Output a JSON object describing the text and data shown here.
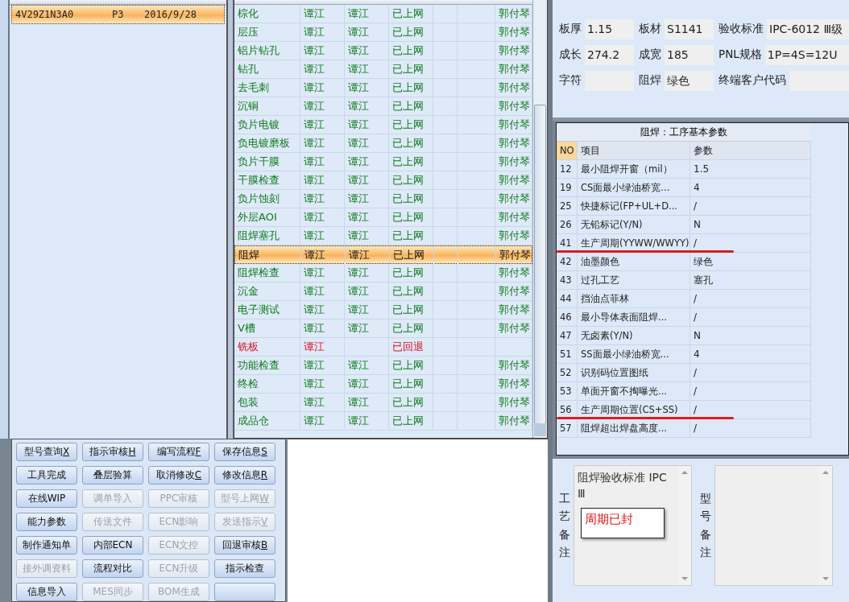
{
  "order_list": {
    "rows": [
      {
        "model": "4V29Z1N3A0",
        "layer": "P3",
        "date": "2016/9/28",
        "selected": true
      }
    ]
  },
  "process_table": {
    "rows": [
      {
        "step": "棕化",
        "operator": "谭江",
        "checker": "谭江",
        "state": "已上网",
        "owner": "郭付琴",
        "returned": false,
        "selected": false
      },
      {
        "step": "层压",
        "operator": "谭江",
        "checker": "谭江",
        "state": "已上网",
        "owner": "郭付琴",
        "returned": false,
        "selected": false
      },
      {
        "step": "铝片钻孔",
        "operator": "谭江",
        "checker": "谭江",
        "state": "已上网",
        "owner": "郭付琴",
        "returned": false,
        "selected": false
      },
      {
        "step": "钻孔",
        "operator": "谭江",
        "checker": "谭江",
        "state": "已上网",
        "owner": "郭付琴",
        "returned": false,
        "selected": false
      },
      {
        "step": "去毛刺",
        "operator": "谭江",
        "checker": "谭江",
        "state": "已上网",
        "owner": "郭付琴",
        "returned": false,
        "selected": false
      },
      {
        "step": "沉铜",
        "operator": "谭江",
        "checker": "谭江",
        "state": "已上网",
        "owner": "郭付琴",
        "returned": false,
        "selected": false
      },
      {
        "step": "负片电镀",
        "operator": "谭江",
        "checker": "谭江",
        "state": "已上网",
        "owner": "郭付琴",
        "returned": false,
        "selected": false
      },
      {
        "step": "负电镀磨板",
        "operator": "谭江",
        "checker": "谭江",
        "state": "已上网",
        "owner": "郭付琴",
        "returned": false,
        "selected": false
      },
      {
        "step": "负片干膜",
        "operator": "谭江",
        "checker": "谭江",
        "state": "已上网",
        "owner": "郭付琴",
        "returned": false,
        "selected": false
      },
      {
        "step": "干膜检查",
        "operator": "谭江",
        "checker": "谭江",
        "state": "已上网",
        "owner": "郭付琴",
        "returned": false,
        "selected": false
      },
      {
        "step": "负片蚀刻",
        "operator": "谭江",
        "checker": "谭江",
        "state": "已上网",
        "owner": "郭付琴",
        "returned": false,
        "selected": false
      },
      {
        "step": "外层AOI",
        "operator": "谭江",
        "checker": "谭江",
        "state": "已上网",
        "owner": "郭付琴",
        "returned": false,
        "selected": false
      },
      {
        "step": "阻焊塞孔",
        "operator": "谭江",
        "checker": "谭江",
        "state": "已上网",
        "owner": "郭付琴",
        "returned": false,
        "selected": false
      },
      {
        "step": "阻焊",
        "operator": "谭江",
        "checker": "谭江",
        "state": "已上网",
        "owner": "郭付琴",
        "returned": false,
        "selected": true
      },
      {
        "step": "阻焊检查",
        "operator": "谭江",
        "checker": "谭江",
        "state": "已上网",
        "owner": "郭付琴",
        "returned": false,
        "selected": false
      },
      {
        "step": "沉金",
        "operator": "谭江",
        "checker": "谭江",
        "state": "已上网",
        "owner": "郭付琴",
        "returned": false,
        "selected": false
      },
      {
        "step": "电子测试",
        "operator": "谭江",
        "checker": "谭江",
        "state": "已上网",
        "owner": "郭付琴",
        "returned": false,
        "selected": false
      },
      {
        "step": "V槽",
        "operator": "谭江",
        "checker": "谭江",
        "state": "已上网",
        "owner": "郭付琴",
        "returned": false,
        "selected": false
      },
      {
        "step": "铣板",
        "operator": "谭江",
        "state": "已回退",
        "returned": true,
        "selected": false
      },
      {
        "step": "功能检查",
        "operator": "谭江",
        "checker": "谭江",
        "state": "已上网",
        "owner": "郭付琴",
        "returned": false,
        "selected": false
      },
      {
        "step": "终检",
        "operator": "谭江",
        "checker": "谭江",
        "state": "已上网",
        "owner": "郭付琴",
        "returned": false,
        "selected": false
      },
      {
        "step": "包装",
        "operator": "谭江",
        "checker": "谭江",
        "state": "已上网",
        "owner": "郭付琴",
        "returned": false,
        "selected": false
      },
      {
        "step": "成品仓",
        "operator": "谭江",
        "checker": "谭江",
        "state": "已上网",
        "owner": "郭付琴",
        "returned": false,
        "selected": false
      }
    ]
  },
  "buttons": [
    {
      "label": "型号查询",
      "key": "X",
      "disabled": false
    },
    {
      "label": "指示审核",
      "key": "H",
      "disabled": false
    },
    {
      "label": "编写流程",
      "key": "F",
      "disabled": false
    },
    {
      "label": "保存信息",
      "key": "S",
      "disabled": false
    },
    {
      "label": "工具完成",
      "disabled": false
    },
    {
      "label": "叠层验算",
      "disabled": false
    },
    {
      "label": "取消修改",
      "key": "C",
      "disabled": false
    },
    {
      "label": "修改信息",
      "key": "R",
      "disabled": false
    },
    {
      "label": "在线WIP",
      "disabled": false
    },
    {
      "label": "调单导入",
      "disabled": true
    },
    {
      "label": "PPC审核",
      "disabled": true
    },
    {
      "label": "型号上网",
      "key": "W",
      "disabled": true
    },
    {
      "label": "能力参数",
      "disabled": false
    },
    {
      "label": "传送文件",
      "disabled": true
    },
    {
      "label": "ECN影响",
      "disabled": true
    },
    {
      "label": "发送指示",
      "key": "V",
      "disabled": true
    },
    {
      "label": "制作通知单",
      "disabled": false
    },
    {
      "label": "内部ECN",
      "disabled": false
    },
    {
      "label": "ECN文控",
      "disabled": true
    },
    {
      "label": "回退审核",
      "key": "B",
      "disabled": false
    },
    {
      "label": "接外调资料",
      "disabled": true
    },
    {
      "label": "流程对比",
      "disabled": false
    },
    {
      "label": "ECN升级",
      "disabled": true
    },
    {
      "label": "指示检查",
      "disabled": false
    },
    {
      "label": "信息导入",
      "disabled": false
    },
    {
      "label": "MES同步",
      "disabled": true
    },
    {
      "label": "BOM生成",
      "disabled": true
    },
    {
      "disabled": false
    }
  ],
  "info_fields": [
    [
      {
        "label": "板厚",
        "value": "1.15"
      },
      {
        "label": "板材",
        "value": "S1141"
      },
      {
        "label": "验收标准",
        "value": "IPC-6012 Ⅲ级"
      }
    ],
    [
      {
        "label": "成长",
        "value": "274.2"
      },
      {
        "label": "成宽",
        "value": "185"
      },
      {
        "label": "PNL规格",
        "value": "1P=4S=12U"
      }
    ],
    [
      {
        "label": "字符"
      },
      {
        "label": "阻焊",
        "value": "绿色"
      },
      {
        "label": "终端客户代码"
      }
    ]
  ],
  "params": {
    "title": "阻焊：工序基本参数",
    "columns": [
      "NO",
      "项目",
      "参数"
    ],
    "rows": [
      {
        "no": "12",
        "item": "最小阻焊开窗（mil）",
        "value": "1.5",
        "marked": false
      },
      {
        "no": "19",
        "item": "CS面最小绿油桥宽...",
        "value": "4",
        "marked": false
      },
      {
        "no": "25",
        "item": "快捷标记(FP+UL+D...",
        "value": "/",
        "marked": false
      },
      {
        "no": "26",
        "item": "无铅标记(Y/N)",
        "value": "N",
        "marked": false
      },
      {
        "no": "41",
        "item": "生产周期(YYWW/WWYY)",
        "value": "/",
        "marked": true
      },
      {
        "no": "42",
        "item": "油墨颜色",
        "value": "绿色",
        "marked": false
      },
      {
        "no": "43",
        "item": "过孔工艺",
        "value": "塞孔",
        "marked": false
      },
      {
        "no": "44",
        "item": "挡油点菲林",
        "value": "/",
        "marked": false
      },
      {
        "no": "46",
        "item": "最小导体表面阻焊...",
        "value": "/",
        "marked": false
      },
      {
        "no": "47",
        "item": "无卤素(Y/N)",
        "value": "N",
        "marked": false
      },
      {
        "no": "51",
        "item": "SS面最小绿油桥宽...",
        "value": "4",
        "marked": false
      },
      {
        "no": "52",
        "item": "识别码位置图纸",
        "value": "/",
        "marked": false
      },
      {
        "no": "53",
        "item": "单面开窗不掏曝光...",
        "value": "/",
        "marked": false
      },
      {
        "no": "56",
        "item": "生产周期位置(CS+SS)",
        "value": "/",
        "marked": true
      },
      {
        "no": "57",
        "item": "阻焊超出焊盘高度...",
        "value": "/",
        "marked": false
      }
    ]
  },
  "process_note": {
    "label": "工艺备注",
    "text": "阻焊验收标准 IPC Ⅲ",
    "popup": "周期已封"
  },
  "model_note": {
    "label": "型号备注"
  }
}
